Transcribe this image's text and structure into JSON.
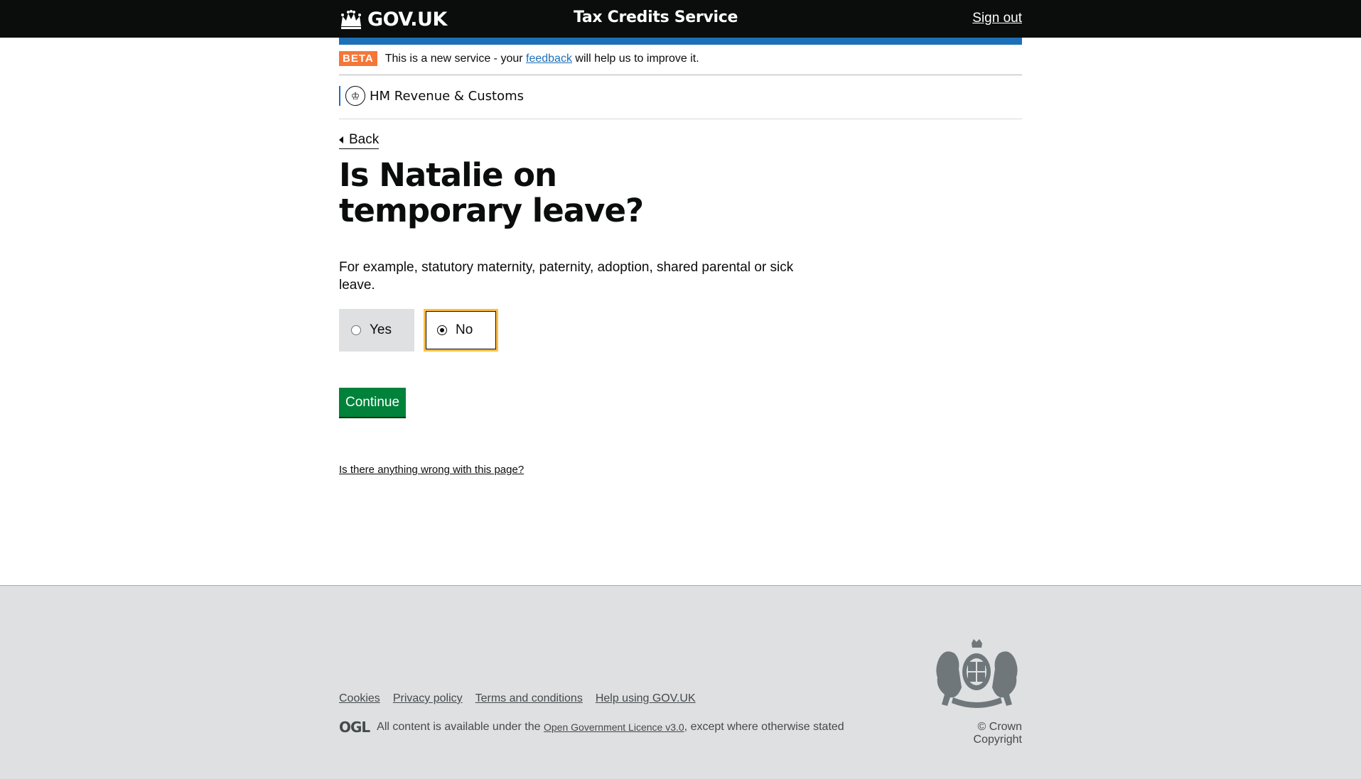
{
  "header": {
    "logo_text": "GOV.UK",
    "service_name": "Tax Credits Service",
    "sign_out": "Sign out"
  },
  "phase_banner": {
    "tag": "BETA",
    "text_before": "This is a new service - your ",
    "link": "feedback",
    "text_after": " will help us to improve it."
  },
  "organisation": {
    "name": "HM Revenue & Customs"
  },
  "back_link": "Back",
  "question": {
    "title": "Is Natalie on temporary leave?",
    "hint": "For example, statutory maternity, paternity, adoption, shared parental or sick leave.",
    "options": [
      {
        "label": "Yes",
        "selected": false
      },
      {
        "label": "No",
        "selected": true
      }
    ]
  },
  "continue_button": "Continue",
  "report_problem": "Is there anything wrong with this page?",
  "footer": {
    "links": [
      "Cookies",
      "Privacy policy",
      "Terms and conditions",
      "Help using GOV.UK"
    ],
    "ogl_logo": "OGL",
    "licence_before": "All content is available under the ",
    "licence_link": "Open Government Licence v3.0",
    "licence_after": ", except where otherwise stated",
    "copyright": "© Crown Copyright"
  },
  "colors": {
    "header_bg": "#0b0c0c",
    "blue_bar": "#1d70b8",
    "beta_tag": "#f47738",
    "button_green": "#00823b",
    "focus_yellow": "#ffbf47",
    "footer_bg": "#dee0e2"
  }
}
